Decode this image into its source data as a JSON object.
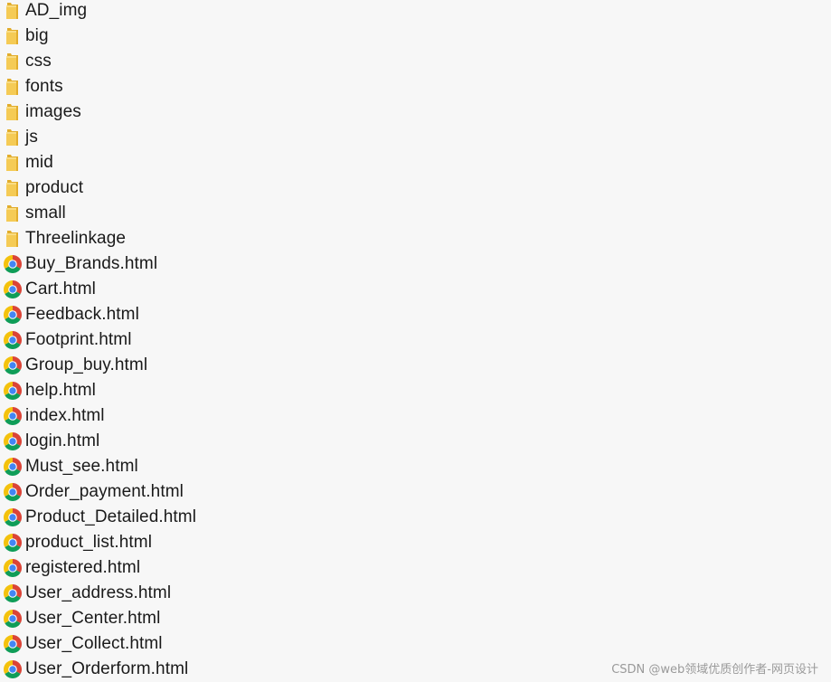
{
  "items": [
    {
      "name": "AD_img",
      "kind": "folder"
    },
    {
      "name": "big",
      "kind": "folder"
    },
    {
      "name": "css",
      "kind": "folder"
    },
    {
      "name": "fonts",
      "kind": "folder"
    },
    {
      "name": "images",
      "kind": "folder"
    },
    {
      "name": "js",
      "kind": "folder"
    },
    {
      "name": "mid",
      "kind": "folder"
    },
    {
      "name": "product",
      "kind": "folder"
    },
    {
      "name": "small",
      "kind": "folder"
    },
    {
      "name": "Threelinkage",
      "kind": "folder"
    },
    {
      "name": "Buy_Brands.html",
      "kind": "html"
    },
    {
      "name": "Cart.html",
      "kind": "html"
    },
    {
      "name": "Feedback.html",
      "kind": "html"
    },
    {
      "name": "Footprint.html",
      "kind": "html"
    },
    {
      "name": "Group_buy.html",
      "kind": "html"
    },
    {
      "name": "help.html",
      "kind": "html"
    },
    {
      "name": "index.html",
      "kind": "html"
    },
    {
      "name": "login.html",
      "kind": "html"
    },
    {
      "name": "Must_see.html",
      "kind": "html"
    },
    {
      "name": "Order_payment.html",
      "kind": "html"
    },
    {
      "name": "Product_Detailed.html",
      "kind": "html"
    },
    {
      "name": "product_list.html",
      "kind": "html"
    },
    {
      "name": "registered.html",
      "kind": "html"
    },
    {
      "name": "User_address.html",
      "kind": "html"
    },
    {
      "name": "User_Center.html",
      "kind": "html"
    },
    {
      "name": "User_Collect.html",
      "kind": "html"
    },
    {
      "name": "User_Orderform.html",
      "kind": "html"
    }
  ],
  "icons": {
    "folder": "folder-icon",
    "html": "chrome-html-file-icon"
  },
  "colors": {
    "background": "#f7f7f7",
    "folder": "#f5cb55",
    "folder_dark": "#e2ad2c",
    "chrome_red": "#db4437",
    "chrome_yellow": "#f4c20d",
    "chrome_green": "#0f9d58",
    "chrome_blue": "#4285f4"
  },
  "watermark": "CSDN @web领域优质创作者-网页设计"
}
